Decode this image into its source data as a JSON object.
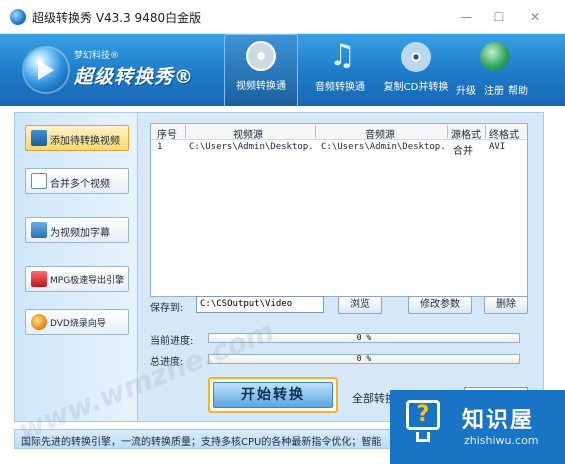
{
  "window": {
    "title": "超级转换秀 V43.3 9480白金版",
    "controls": {
      "minimize": "—",
      "maximize": "☐",
      "close": "✕"
    }
  },
  "brand": {
    "company": "梦幻科技®",
    "name": "超级转换秀®"
  },
  "nav": {
    "video": "视频转换通",
    "audio": "音频转换通",
    "cd": "复制CD并转换",
    "upgrade": "升级",
    "register": "注册",
    "help": "帮助"
  },
  "sidebar": {
    "items": [
      {
        "label": "添加待转换视频",
        "icon": "add-video-icon",
        "active": true
      },
      {
        "label": "合并多个视频",
        "icon": "merge-icon",
        "active": false
      },
      {
        "label": "为视频加字幕",
        "icon": "subtitle-icon",
        "active": false
      },
      {
        "label": "MPG极速导出引擎",
        "icon": "mpg-icon",
        "active": false
      },
      {
        "label": "DVD烧录向导",
        "icon": "dvd-icon",
        "active": false
      }
    ]
  },
  "file_list": {
    "columns": [
      "序号",
      "视频源",
      "音频源",
      "源格式",
      "终格式"
    ],
    "rows": [
      [
        "1",
        "C:\\Users\\Admin\\Desktop...",
        "C:\\Users\\Admin\\Desktop...",
        "合并",
        "AVI"
      ]
    ]
  },
  "output": {
    "save_label": "保存到:",
    "save_path": "C:\\CSOutput\\Video",
    "browse": "浏览",
    "params": "修改参数",
    "delete": "删除"
  },
  "progress": {
    "current_label": "当前进度:",
    "current_text": "0 %",
    "current_value": 0,
    "total_label": "总进度:",
    "total_text": "0 %",
    "total_value": 0
  },
  "actions": {
    "start": "开始转换",
    "after_label": "全部转换"
  },
  "statusbar": {
    "text": "国际先进的转换引擎，一流的转换质量；支持多核CPU的各种最新指令优化；智能"
  },
  "badge": {
    "title": "知识屋",
    "subtitle": "zhishiwu.com"
  },
  "watermark": "www.wmzhe.com",
  "colors": {
    "header_blue": "#1d7ac9",
    "accent_yellow": "#f3b330",
    "badge_blue": "#1a74c6"
  }
}
